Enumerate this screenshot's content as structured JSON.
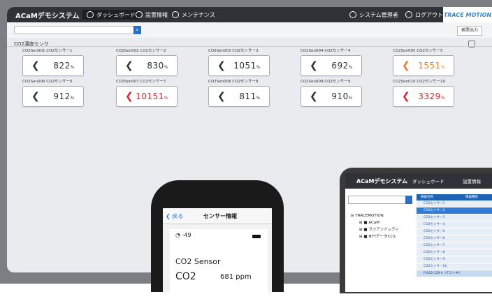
{
  "app": {
    "brand": "ACaMデモシステム",
    "nav": [
      {
        "label": "ダッシュボード",
        "active": true
      },
      {
        "label": "設置情報"
      },
      {
        "label": "メンテナンス"
      }
    ],
    "right_nav": [
      {
        "label": "システム管理者"
      },
      {
        "label": "ログアウト"
      }
    ],
    "trace_label": "TRACE MOTION"
  },
  "toolbar": {
    "search_value": "",
    "export_label": "帳票出力"
  },
  "section": {
    "title": "CO2濃度センサ"
  },
  "sensors": [
    {
      "label": "CO2Sen001 CO2センサー1",
      "value": "822",
      "unit": "%",
      "state": "normal"
    },
    {
      "label": "CO2Sen002 CO2センサー2",
      "value": "830",
      "unit": "%",
      "state": "normal"
    },
    {
      "label": "CO2Sen003 CO2センサー3",
      "value": "1051",
      "unit": "%",
      "state": "normal"
    },
    {
      "label": "CO2Sen004 CO2センサー4",
      "value": "692",
      "unit": "%",
      "state": "normal"
    },
    {
      "label": "CO2Sen005 CO2センサー5",
      "value": "1551",
      "unit": "%",
      "state": "warn"
    },
    {
      "label": "CO2Sen006 CO2センサー6",
      "value": "912",
      "unit": "%",
      "state": "normal"
    },
    {
      "label": "CO2Sen007 CO2センサー7",
      "value": "10151",
      "unit": "%",
      "state": "alert"
    },
    {
      "label": "CO2Sen008 CO2センサー8",
      "value": "811",
      "unit": "%",
      "state": "normal"
    },
    {
      "label": "CO2Sen009 CO2センサー9",
      "value": "910",
      "unit": "%",
      "state": "normal"
    },
    {
      "label": "CO2Sen010 CO2センサー10",
      "value": "3329",
      "unit": "%",
      "state": "alert"
    }
  ],
  "phone": {
    "back_label": "戻る",
    "title": "センサー情報",
    "signal": "-49",
    "sensor_name": "CO2 Sensor",
    "metric_label": "CO2",
    "metric_value": "681 ppm"
  },
  "tablet": {
    "brand": "ACaMデモシステム",
    "nav1": "ダッシュボード",
    "nav2": "設置情報",
    "tree": [
      "TRACEMOTION",
      "ACaM",
      "ラフアンドレディ",
      "NTTデータCCS"
    ],
    "table_headers": [
      "機器名称",
      "機器種別"
    ],
    "rows": [
      "CO2センサー1",
      "CO2センサー2",
      "CO2センサー3",
      "CO2センサー4",
      "CO2センサー5",
      "CO2センサー6",
      "CO2センサー7",
      "CO2センサー8",
      "CO2センサー9",
      "CO2センサー10",
      "Pt100-139-4（テスト中）"
    ]
  },
  "colors": {
    "topbar": "#2f3237",
    "accent": "#2b6fc0",
    "warn": "#ec7a2b",
    "alert": "#d9262c"
  }
}
